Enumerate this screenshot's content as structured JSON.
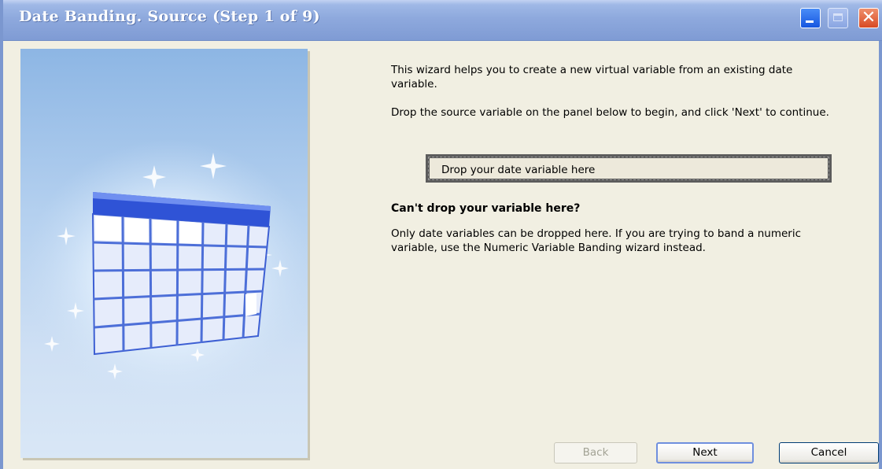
{
  "window": {
    "title": "Date Banding.  Source (Step 1 of 9)",
    "controls": [
      "minimize-icon",
      "maximize-icon",
      "close-icon"
    ]
  },
  "intro": {
    "line1": "This wizard helps you to create a new virtual variable from an existing date variable.",
    "line2": "Drop the source variable on the panel below to begin, and click 'Next' to continue."
  },
  "dropzone": {
    "label": "Drop your date variable here"
  },
  "help": {
    "heading": "Can't drop your variable here?",
    "text": "Only date variables can be dropped here. If you are trying to band a numeric variable, use the Numeric Variable Banding wizard instead."
  },
  "buttons": {
    "back": "Back",
    "next": "Next",
    "cancel": "Cancel"
  },
  "colors": {
    "titlebar": "#8ea9dd",
    "calendar_header": "#2f53d6",
    "close_button": "#d84a23"
  }
}
